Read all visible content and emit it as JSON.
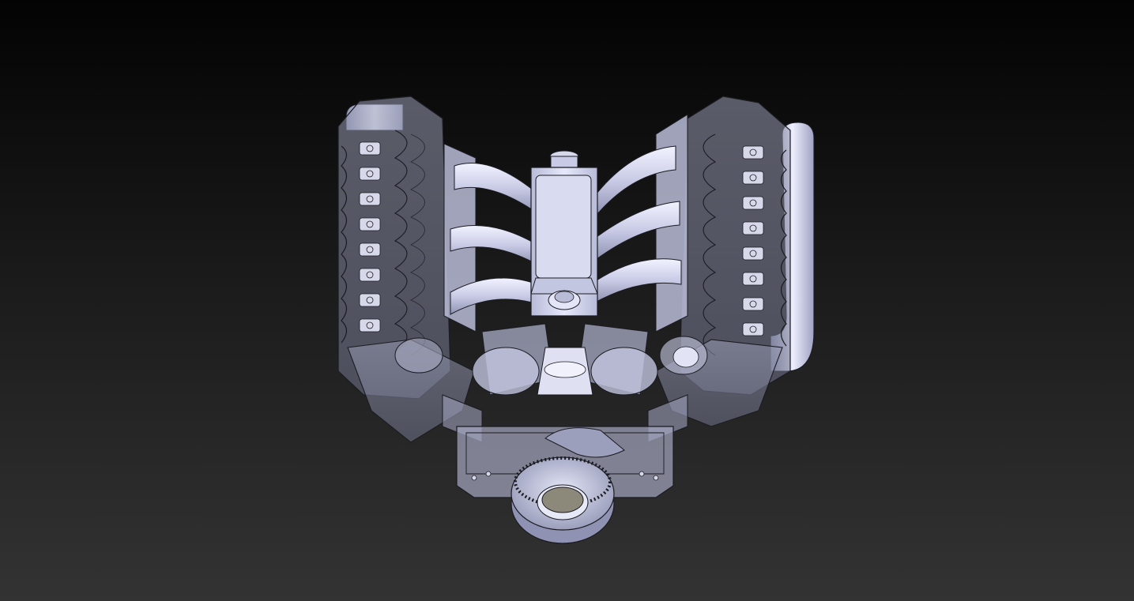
{
  "viewport": {
    "background_top": "#030303",
    "background_bottom": "#333333"
  },
  "model": {
    "icon": "v8-engine-assembly-icon",
    "display_mode": "shaded-with-edges-transparent",
    "colors": {
      "part_fill": "#c9cbe6",
      "part_highlight": "#eceefc",
      "part_shadow": "#8f92b2",
      "transparent_body": "#b7bacf",
      "edge_line": "#1b1b22",
      "bore_inner": "#8c897a"
    }
  }
}
